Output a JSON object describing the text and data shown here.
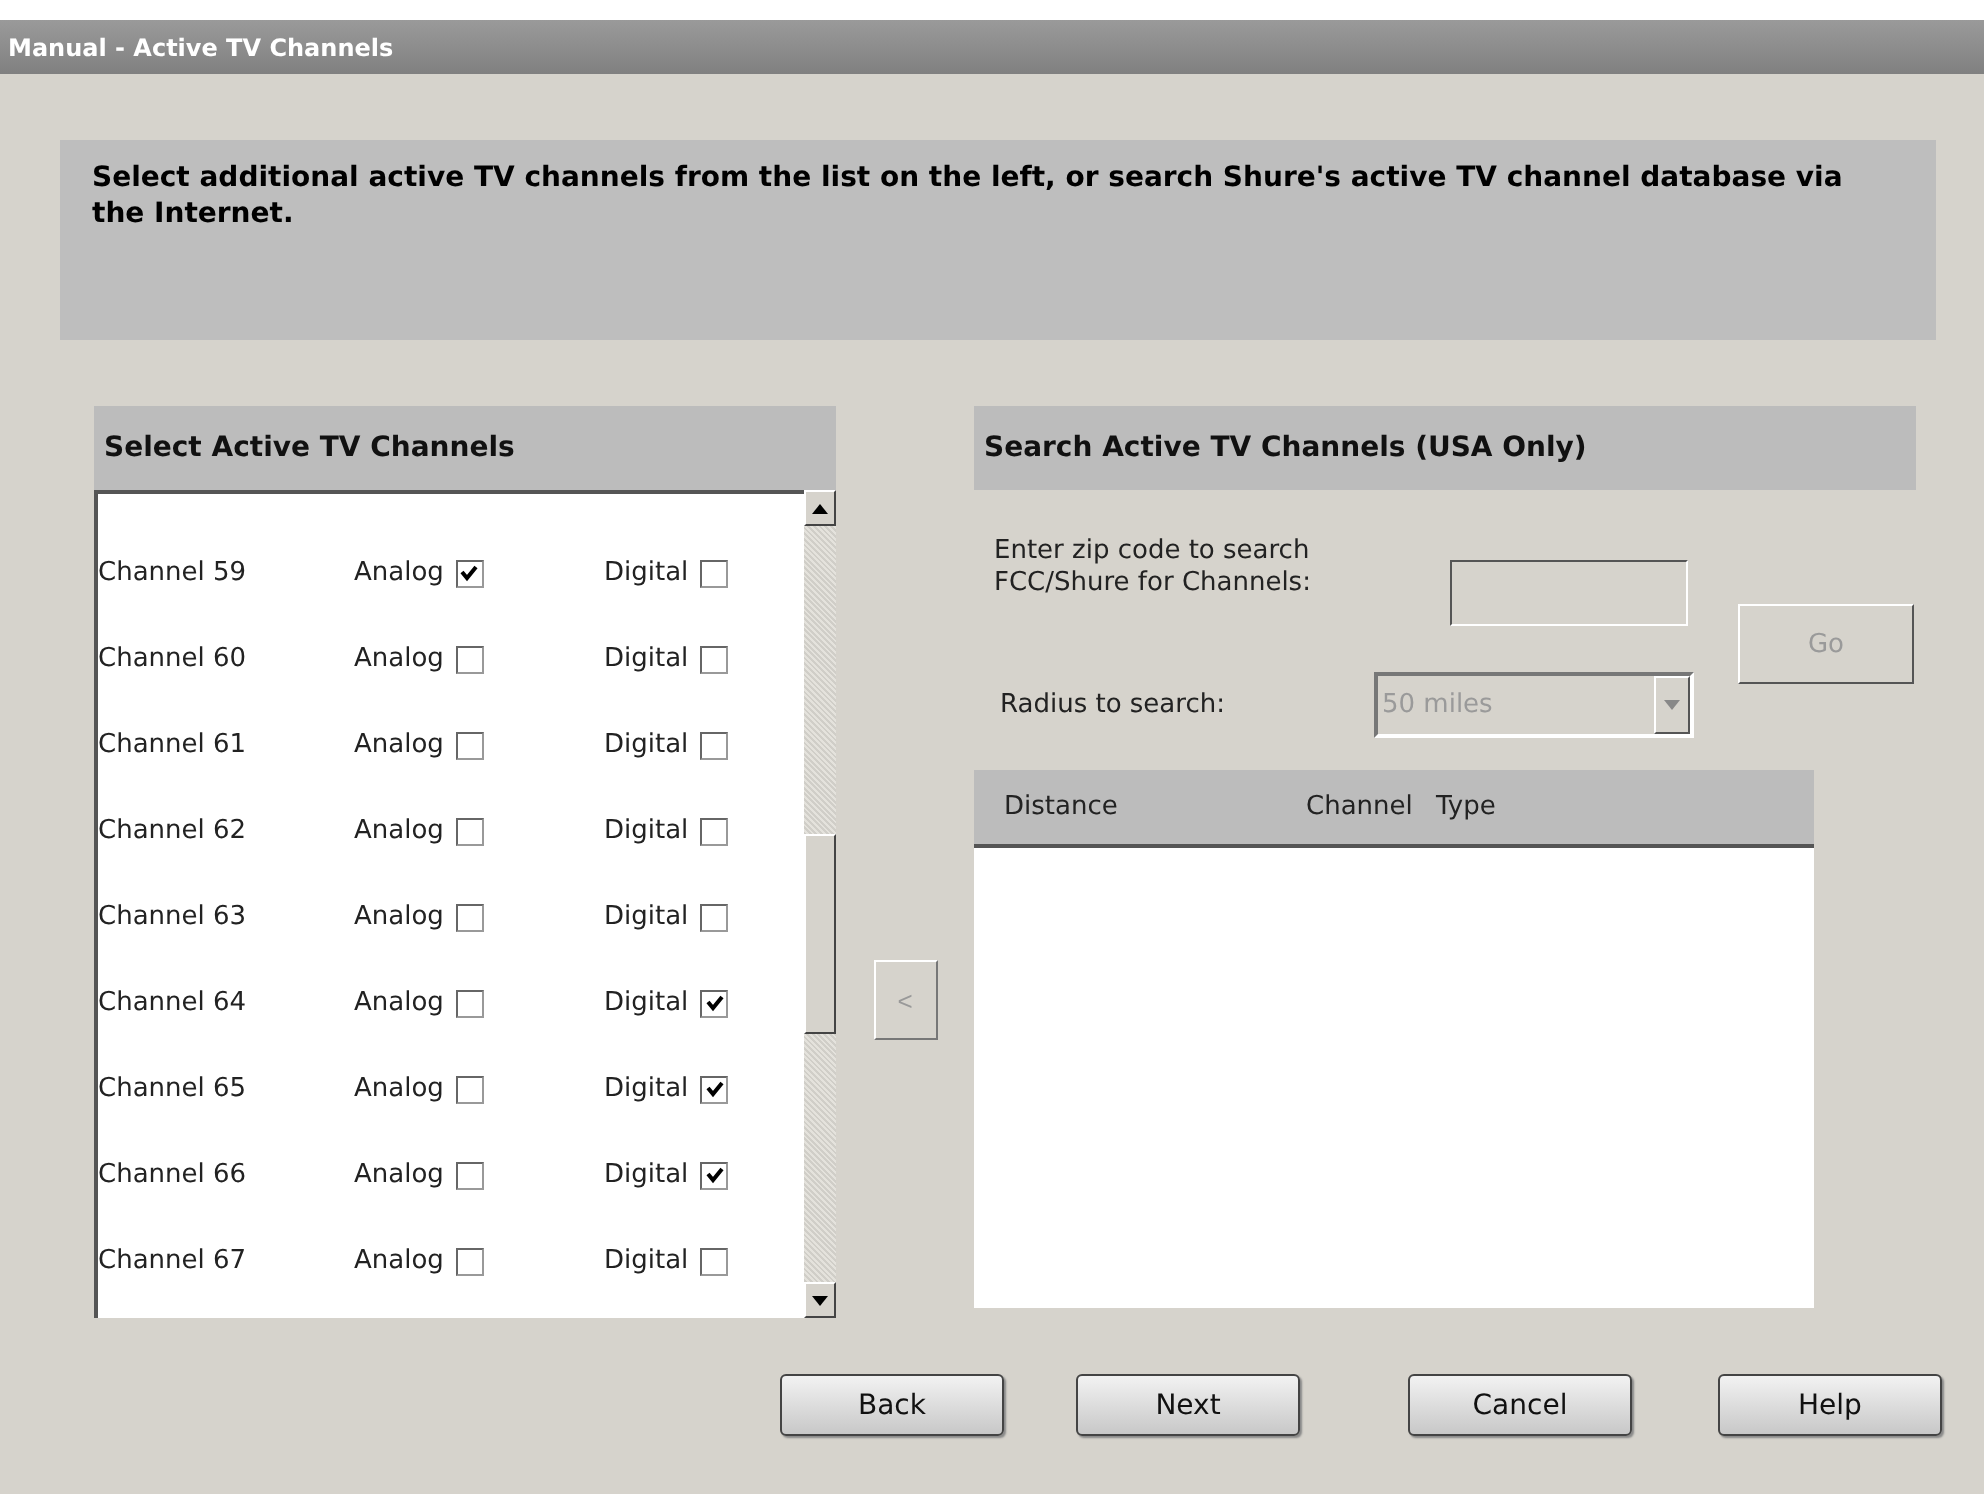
{
  "window": {
    "title": "Manual - Active TV Channels"
  },
  "instructions": "Select additional active TV channels from the list on the left, or search Shure's active TV channel database via the Internet.",
  "select_panel": {
    "title": "Select Active TV Channels",
    "channels": [
      {
        "name": "Channel 59",
        "analog_label": "Analog",
        "analog": true,
        "digital_label": "Digital",
        "digital": false
      },
      {
        "name": "Channel 60",
        "analog_label": "Analog",
        "analog": false,
        "digital_label": "Digital",
        "digital": false
      },
      {
        "name": "Channel 61",
        "analog_label": "Analog",
        "analog": false,
        "digital_label": "Digital",
        "digital": false
      },
      {
        "name": "Channel 62",
        "analog_label": "Analog",
        "analog": false,
        "digital_label": "Digital",
        "digital": false
      },
      {
        "name": "Channel 63",
        "analog_label": "Analog",
        "analog": false,
        "digital_label": "Digital",
        "digital": false
      },
      {
        "name": "Channel 64",
        "analog_label": "Analog",
        "analog": false,
        "digital_label": "Digital",
        "digital": true
      },
      {
        "name": "Channel 65",
        "analog_label": "Analog",
        "analog": false,
        "digital_label": "Digital",
        "digital": true
      },
      {
        "name": "Channel 66",
        "analog_label": "Analog",
        "analog": false,
        "digital_label": "Digital",
        "digital": true
      },
      {
        "name": "Channel 67",
        "analog_label": "Analog",
        "analog": false,
        "digital_label": "Digital",
        "digital": false
      }
    ]
  },
  "add_button": {
    "label": "<",
    "disabled": true
  },
  "search_panel": {
    "title": "Search Active TV Channels (USA Only)",
    "zip_label": "Enter zip code to search FCC/Shure for Channels:",
    "go_button": {
      "label": "Go",
      "disabled": true
    },
    "radius_label": "Radius to search:",
    "radius": {
      "value": "50 miles",
      "disabled": true
    },
    "columns": [
      "Distance",
      "Channel",
      "Type"
    ]
  },
  "buttons": [
    "Back",
    "Next",
    "Cancel",
    "Help"
  ]
}
